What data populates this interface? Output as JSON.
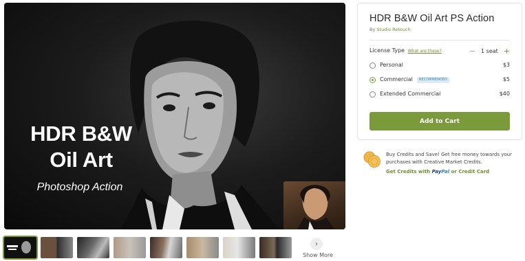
{
  "hero": {
    "title_line1": "HDR B&W",
    "title_line2": "Oil Art",
    "subtitle": "Photoshop Action"
  },
  "thumbnails": {
    "count": 8,
    "active_index": 0,
    "show_more_label": "Show More"
  },
  "product": {
    "title": "HDR B&W Oil Art PS Action",
    "by_prefix": "By",
    "author": "Studio Retouch",
    "license_label": "License Type",
    "license_help_link": "What are these?",
    "seat_text": "1 seat",
    "options": [
      {
        "name": "Personal",
        "price": "$3",
        "selected": false,
        "badge": ""
      },
      {
        "name": "Commercial",
        "price": "$5",
        "selected": true,
        "badge": "RECOMMENDED"
      },
      {
        "name": "Extended Commercial",
        "price": "$40",
        "selected": false,
        "badge": ""
      }
    ],
    "add_to_cart_label": "Add to Cart"
  },
  "credits": {
    "promo_text": "Buy Credits and Save! Get free money towards your purchases with Creative Market Credits.",
    "link_prefix": "Get Credits with",
    "paypal_pay": "Pay",
    "paypal_pal": "Pal",
    "link_suffix": "or Credit Card"
  },
  "colors": {
    "accent_green": "#7a9a3b",
    "badge_blue": "#3c7fb1"
  }
}
